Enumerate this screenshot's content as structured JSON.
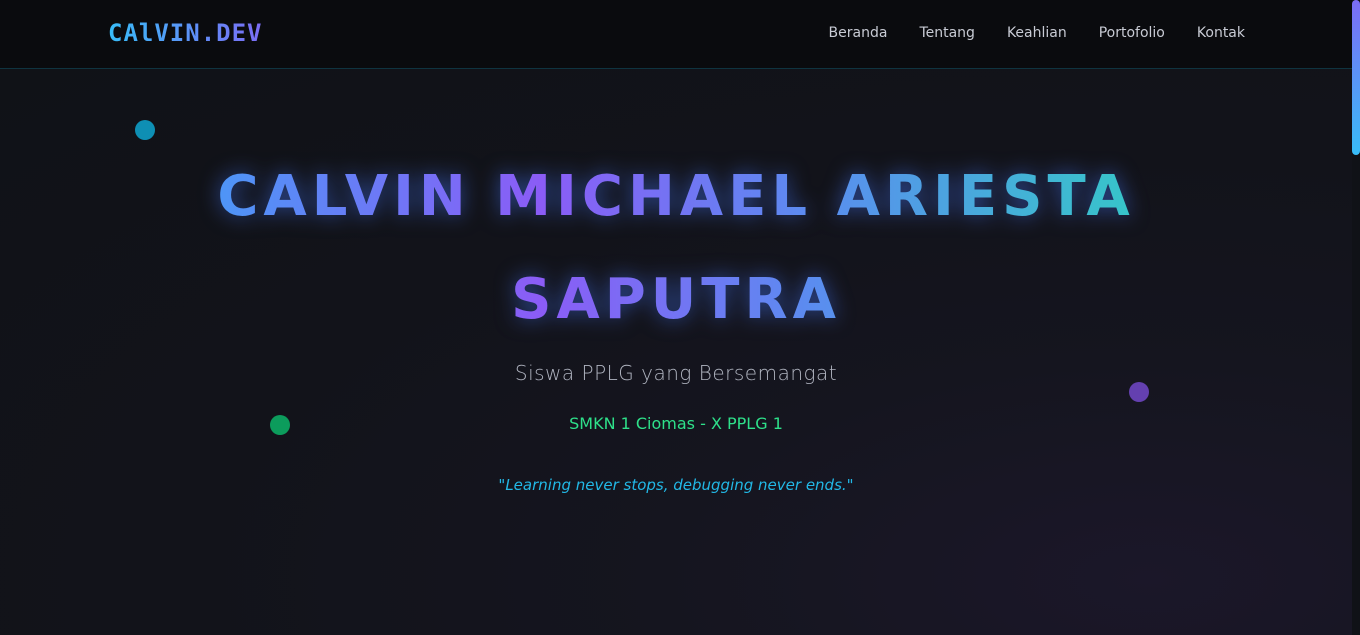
{
  "navbar": {
    "logo": "CAlVIN.DEV",
    "links": [
      "Beranda",
      "Tentang",
      "Keahlian",
      "Portofolio",
      "Kontak"
    ]
  },
  "hero": {
    "title_line1": "CALVIN MICHAEL ARIESTA",
    "title_line2": "SAPUTRA",
    "subtitle": "Siswa PPLG yang Bersemangat",
    "school": "SMKN 1 Ciomas - X PPLG 1",
    "quote": "\"Learning never stops, debugging never ends.\""
  },
  "colors": {
    "background": "#101217",
    "navbar_bg": "#0a0b0e",
    "accent_blue": "#38bdf8",
    "accent_purple": "#8b5cf6",
    "accent_teal": "#2dd4bf",
    "school_green": "#2ee08a",
    "quote_cyan": "#22b8e6"
  }
}
